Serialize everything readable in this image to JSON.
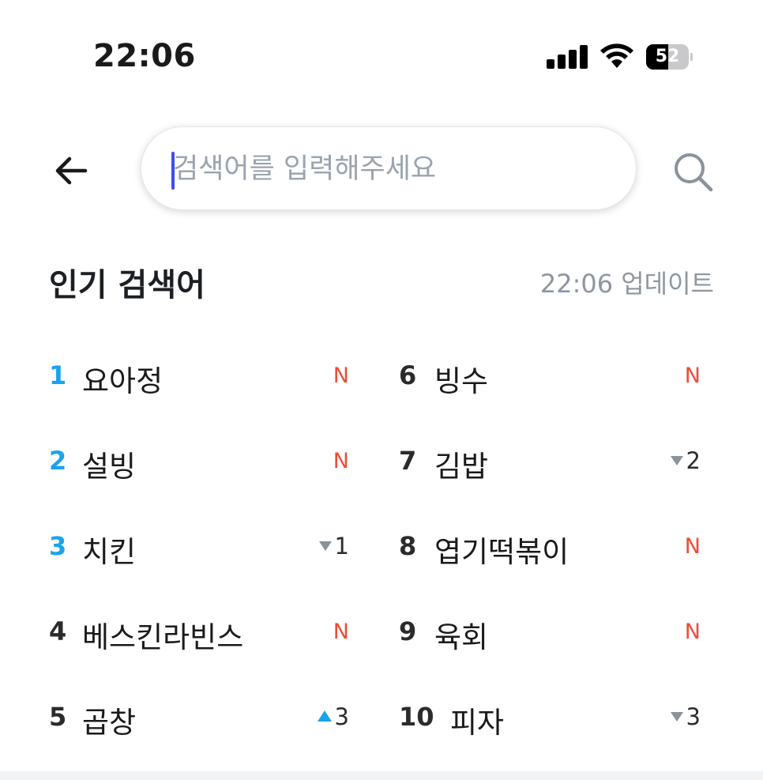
{
  "status_bar": {
    "time": "22:06",
    "battery_level": "52",
    "battery_fraction": 0.52,
    "icons": [
      "signal-icon",
      "wifi-icon",
      "battery-icon"
    ]
  },
  "search": {
    "placeholder": "검색어를 입력해주세요",
    "value": "",
    "back_icon": "arrow-left-icon",
    "search_icon": "search-icon",
    "caret_color": "#3b4ef5"
  },
  "section": {
    "title": "인기 검색어",
    "updated": "22:06 업데이트"
  },
  "colors": {
    "top_rank": "#1aa3ec",
    "new_badge": "#f04b36",
    "down_arrow": "#8a929b",
    "up_arrow": "#1aa3ec"
  },
  "rankings": [
    {
      "rank": "1",
      "keyword": "요아정",
      "change": "N",
      "type": "new"
    },
    {
      "rank": "2",
      "keyword": "설빙",
      "change": "N",
      "type": "new"
    },
    {
      "rank": "3",
      "keyword": "치킨",
      "change": "1",
      "type": "down"
    },
    {
      "rank": "4",
      "keyword": "베스킨라빈스",
      "change": "N",
      "type": "new"
    },
    {
      "rank": "5",
      "keyword": "곱창",
      "change": "3",
      "type": "up"
    },
    {
      "rank": "6",
      "keyword": "빙수",
      "change": "N",
      "type": "new"
    },
    {
      "rank": "7",
      "keyword": "김밥",
      "change": "2",
      "type": "down"
    },
    {
      "rank": "8",
      "keyword": "엽기떡볶이",
      "change": "N",
      "type": "new"
    },
    {
      "rank": "9",
      "keyword": "육회",
      "change": "N",
      "type": "new"
    },
    {
      "rank": "10",
      "keyword": "피자",
      "change": "3",
      "type": "down"
    }
  ]
}
